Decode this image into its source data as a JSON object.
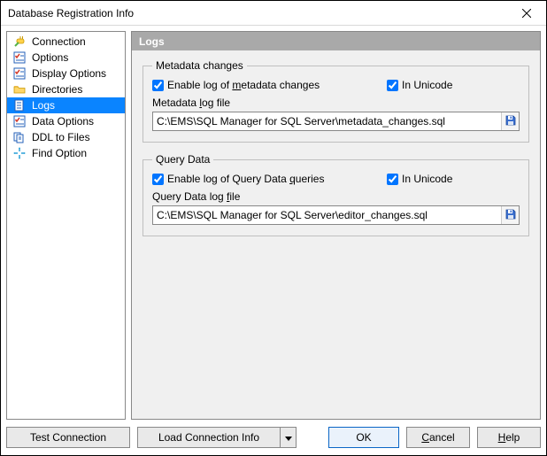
{
  "window": {
    "title": "Database Registration Info"
  },
  "sidebar": {
    "items": [
      {
        "label": "Connection"
      },
      {
        "label": "Options"
      },
      {
        "label": "Display Options"
      },
      {
        "label": "Directories"
      },
      {
        "label": "Logs"
      },
      {
        "label": "Data Options"
      },
      {
        "label": "DDL to Files"
      },
      {
        "label": "Find Option"
      }
    ]
  },
  "panel": {
    "title": "Logs"
  },
  "groups": {
    "metadata": {
      "legend": "Metadata changes",
      "enable_label_pre": "Enable log of ",
      "enable_label_u": "m",
      "enable_label_post": "etadata changes",
      "unicode_label": "In Unicode",
      "file_label_pre": "Metadata ",
      "file_label_u": "l",
      "file_label_post": "og file",
      "file_value": "C:\\EMS\\SQL Manager for SQL Server\\metadata_changes.sql"
    },
    "query": {
      "legend": "Query Data",
      "enable_label_pre": "Enable log of Query Data ",
      "enable_label_u": "q",
      "enable_label_post": "ueries",
      "unicode_label": "In Unicode",
      "file_label_pre": "Query Data log ",
      "file_label_u": "f",
      "file_label_post": "ile",
      "file_value": "C:\\EMS\\SQL Manager for SQL Server\\editor_changes.sql"
    }
  },
  "footer": {
    "test": "Test Connection",
    "load": "Load Connection Info",
    "ok": "OK",
    "cancel_u": "C",
    "cancel_post": "ancel",
    "help_u": "H",
    "help_post": "elp"
  }
}
